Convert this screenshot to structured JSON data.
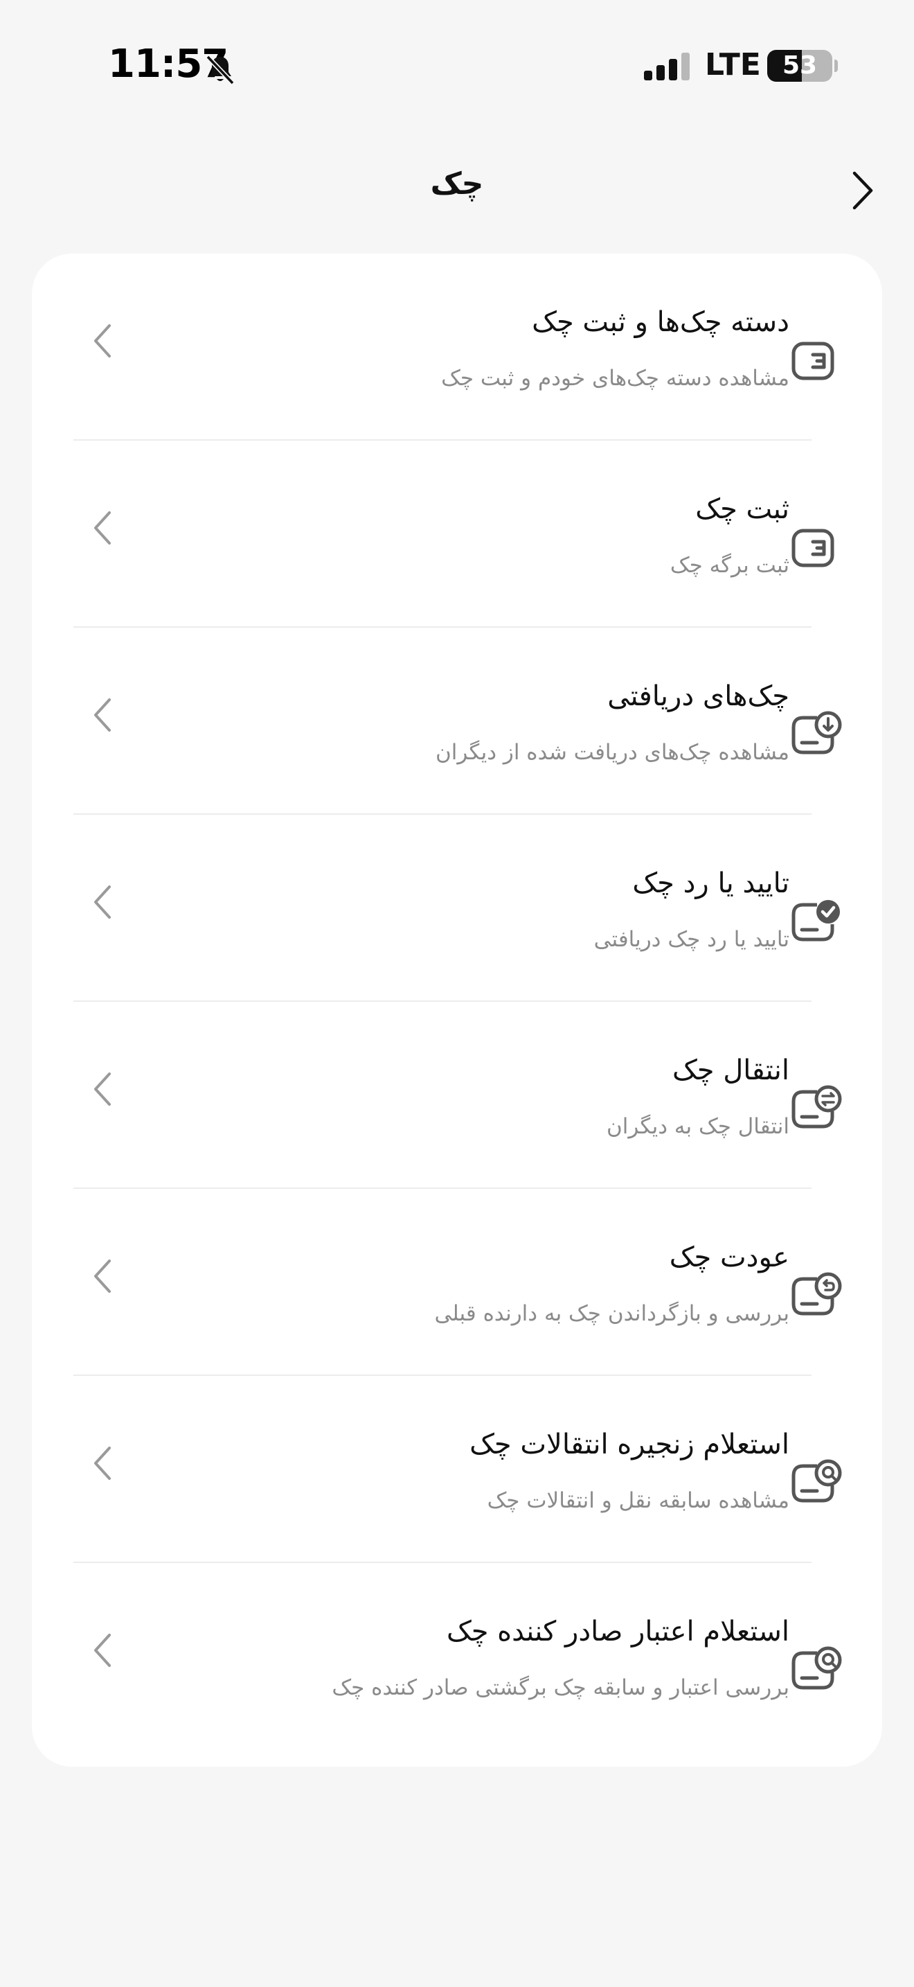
{
  "status_bar": {
    "time": "11:57",
    "network": "LTE",
    "battery_percent": "53",
    "battery_level": 0.53
  },
  "header": {
    "title": "چک"
  },
  "menu": {
    "items": [
      {
        "title": "دسته چک‌ها و ثبت چک",
        "subtitle": "مشاهده دسته چک‌های خودم و ثبت چک",
        "icon": "checkbook-icon"
      },
      {
        "title": "ثبت چک",
        "subtitle": "ثبت برگه چک",
        "icon": "checkbook-icon"
      },
      {
        "title": "چک‌های دریافتی",
        "subtitle": "مشاهده چک‌های دریافت شده از دیگران",
        "icon": "check-download-icon"
      },
      {
        "title": "تایید یا رد چک",
        "subtitle": "تایید یا رد چک دریافتی",
        "icon": "check-approve-icon"
      },
      {
        "title": "انتقال چک",
        "subtitle": "انتقال چک به دیگران",
        "icon": "check-transfer-icon"
      },
      {
        "title": "عودت چک",
        "subtitle": "بررسی و بازگرداندن چک به دارنده قبلی",
        "icon": "check-return-icon"
      },
      {
        "title": "استعلام زنجیره انتقالات چک",
        "subtitle": "مشاهده سابقه نقل و انتقالات چک",
        "icon": "check-inquiry-icon"
      },
      {
        "title": "استعلام اعتبار صادر کننده چک",
        "subtitle": "بررسی اعتبار و سابقه چک برگشتی صادر کننده چک",
        "icon": "check-inquiry-icon"
      }
    ]
  },
  "colors": {
    "background": "#f6f6f6",
    "card": "#ffffff",
    "icon": "#555555",
    "chevron": "#9a9a9a",
    "subtitle": "#8a8a8a"
  }
}
